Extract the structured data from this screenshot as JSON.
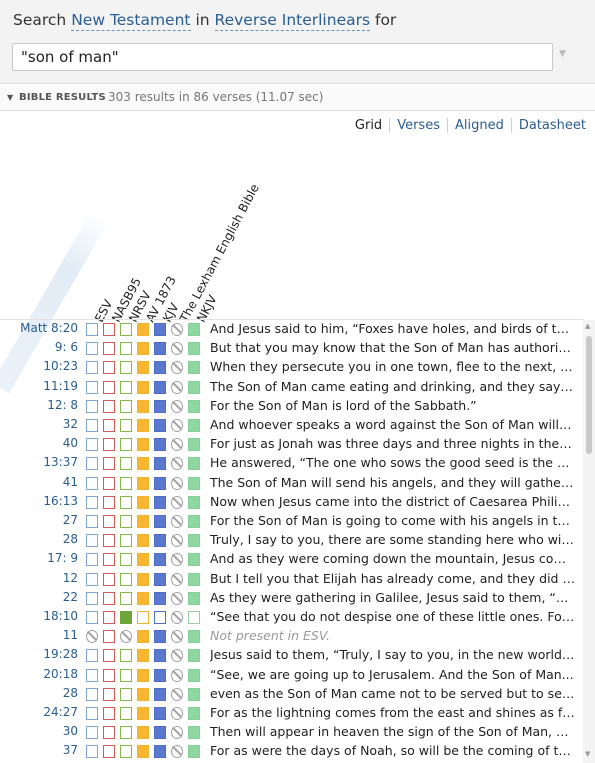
{
  "search": {
    "prefix": "Search",
    "scope": "New Testament",
    "connector": "in",
    "resource": "Reverse Interlinears",
    "suffix": "for",
    "query": "\"son of man\""
  },
  "results": {
    "label": "BIBLE RESULTS",
    "count": "303 results in 86 verses (11.07 sec)"
  },
  "view_tabs": [
    "Grid",
    "Verses",
    "Aligned",
    "Datasheet"
  ],
  "columns": [
    "ESV",
    "NASB95",
    "NRSV",
    "AV 1873",
    "KJV",
    "The Lexham English Bible",
    "NKJV"
  ],
  "colors": {
    "link": "#2a5d8f",
    "esv": "#7da5d8",
    "nasb95": "#d05a5a",
    "nrsv": "#6ea53a",
    "av1873": "#f7b731",
    "kjv": "#5b78cc",
    "nkjv": "#8fd6a0"
  },
  "verses": [
    {
      "ref": "Matt  8:20",
      "text": "And Jesus said to him, “Foxes have holes, and birds of the...",
      "nr": 0,
      "av": 1,
      "kj": 1,
      "nk": 1
    },
    {
      "ref": "9:  6",
      "text": "But that you may know that the Son of Man has authority...",
      "nr": 0,
      "av": 1,
      "kj": 1,
      "nk": 1
    },
    {
      "ref": "10:23",
      "text": "When they persecute you in one town, flee to the next, fo...",
      "nr": 0,
      "av": 1,
      "kj": 1,
      "nk": 1
    },
    {
      "ref": "11:19",
      "text": "The Son of Man came eating and drinking, and they say, ‘L...",
      "nr": 0,
      "av": 1,
      "kj": 1,
      "nk": 1
    },
    {
      "ref": "12:  8",
      "text": "For the Son of Man is lord of the Sabbath.”",
      "nr": 0,
      "av": 1,
      "kj": 1,
      "nk": 1
    },
    {
      "ref": "32",
      "text": "And whoever speaks a word against the Son of Man will b...",
      "nr": 0,
      "av": 1,
      "kj": 1,
      "nk": 1
    },
    {
      "ref": "40",
      "text": "For just as Jonah was three days and three nights in the b...",
      "nr": 0,
      "av": 1,
      "kj": 1,
      "nk": 1
    },
    {
      "ref": "13:37",
      "text": "He answered, “The one who sows the good seed is the So...",
      "nr": 0,
      "av": 1,
      "kj": 1,
      "nk": 1
    },
    {
      "ref": "41",
      "text": "The Son of Man will send his angels, and they will gather...",
      "nr": 0,
      "av": 1,
      "kj": 1,
      "nk": 1
    },
    {
      "ref": "16:13",
      "text": " Now when Jesus came into the district of Caesarea Philip...",
      "nr": 0,
      "av": 1,
      "kj": 1,
      "nk": 1
    },
    {
      "ref": "27",
      "text": "For the Son of Man is going to come with his angels in the...",
      "nr": 0,
      "av": 1,
      "kj": 1,
      "nk": 1
    },
    {
      "ref": "28",
      "text": "Truly, I say to you, there are some standing here who will...",
      "nr": 0,
      "av": 1,
      "kj": 1,
      "nk": 1
    },
    {
      "ref": "17:  9",
      "text": "And as they were coming down the mountain, Jesus com...",
      "nr": 0,
      "av": 1,
      "kj": 1,
      "nk": 1
    },
    {
      "ref": "12",
      "text": "But I tell you that Elijah has already come, and they did no...",
      "nr": 0,
      "av": 1,
      "kj": 1,
      "nk": 1
    },
    {
      "ref": "22",
      "text": " As they were gathering in Galilee, Jesus said to them, “Th...",
      "nr": 0,
      "av": 1,
      "kj": 1,
      "nk": 1
    },
    {
      "ref": "18:10",
      "text": " “See that you do not despise one of these little ones. For...",
      "nr": 1,
      "av": 0,
      "kj": 0,
      "nk": 0
    },
    {
      "ref": "11",
      "text": "Not present in ESV.",
      "absent": true,
      "nr": 0,
      "av": 1,
      "kj": 1,
      "nk": 1
    },
    {
      "ref": "19:28",
      "text": "Jesus said to them, “Truly, I say to you, in the new world,...",
      "nr": 0,
      "av": 1,
      "kj": 1,
      "nk": 1
    },
    {
      "ref": "20:18",
      "text": "“See, we are going up to Jerusalem. And the Son of Man...",
      "nr": 0,
      "av": 1,
      "kj": 1,
      "nk": 1
    },
    {
      "ref": "28",
      "text": "even as the Son of Man came not to be served but to serv...",
      "nr": 0,
      "av": 1,
      "kj": 1,
      "nk": 1
    },
    {
      "ref": "24:27",
      "text": "For as the lightning comes from the east and shines as far...",
      "nr": 0,
      "av": 1,
      "kj": 1,
      "nk": 1
    },
    {
      "ref": "30",
      "text": "Then will appear in heaven the sign of the Son of Man, an...",
      "nr": 0,
      "av": 1,
      "kj": 1,
      "nk": 1
    },
    {
      "ref": "37",
      "text": "For as were the days of Noah, so will be the coming of the...",
      "nr": 0,
      "av": 1,
      "kj": 1,
      "nk": 1
    }
  ]
}
